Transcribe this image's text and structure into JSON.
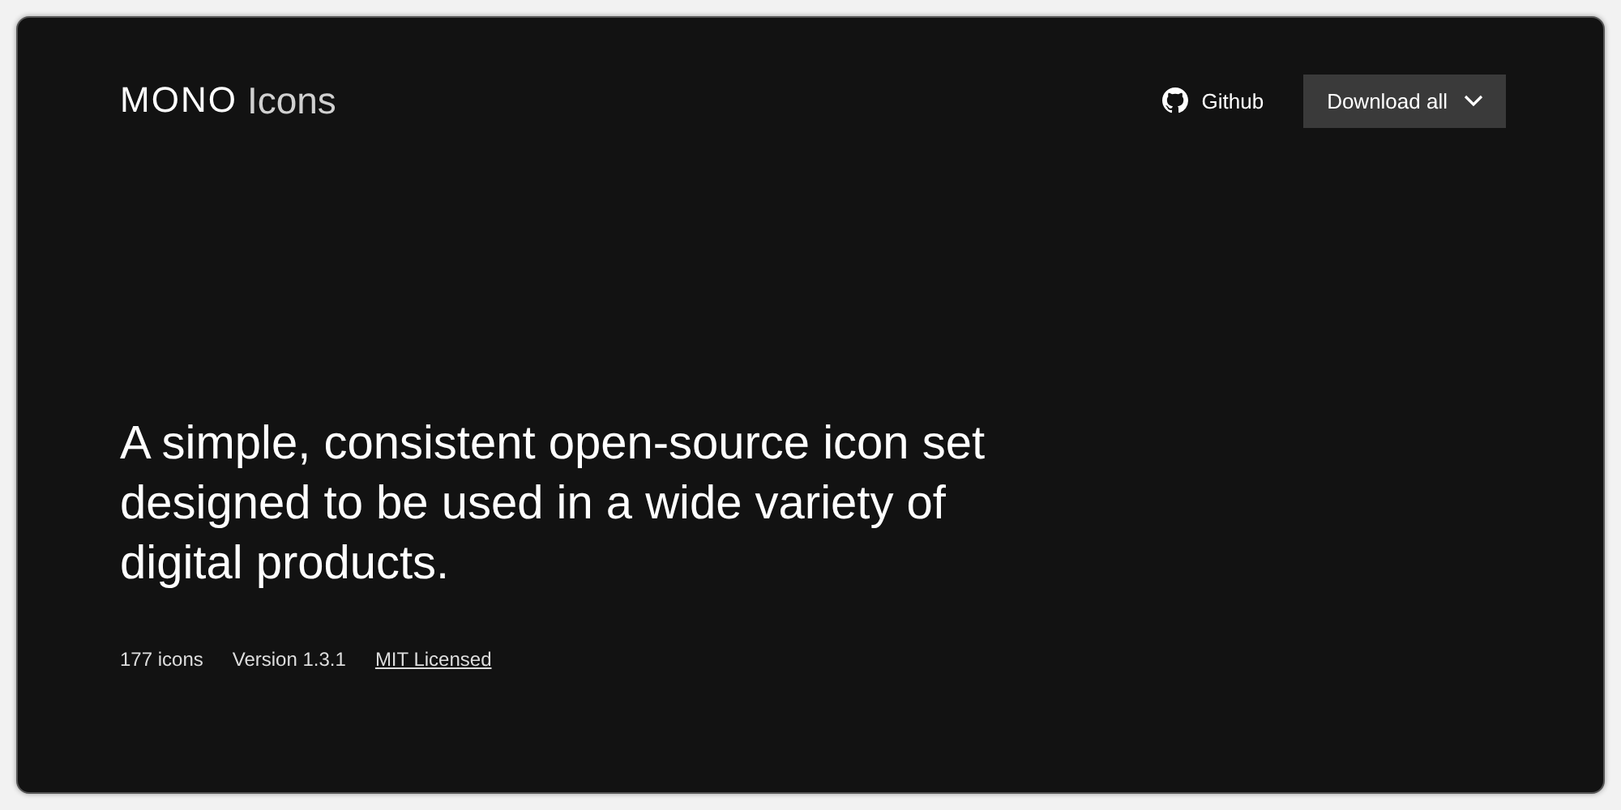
{
  "header": {
    "logo": {
      "mark": "MONO",
      "name": "Icons"
    },
    "github_link": "Github",
    "download_button": "Download all"
  },
  "hero": {
    "headline": "A simple, consistent open-source icon set designed to be used in a wide variety of digital products."
  },
  "meta": [
    {
      "kind": "text",
      "label": "177 icons"
    },
    {
      "kind": "text",
      "label": "Version 1.3.1"
    },
    {
      "kind": "link",
      "label": "MIT Licensed"
    }
  ]
}
